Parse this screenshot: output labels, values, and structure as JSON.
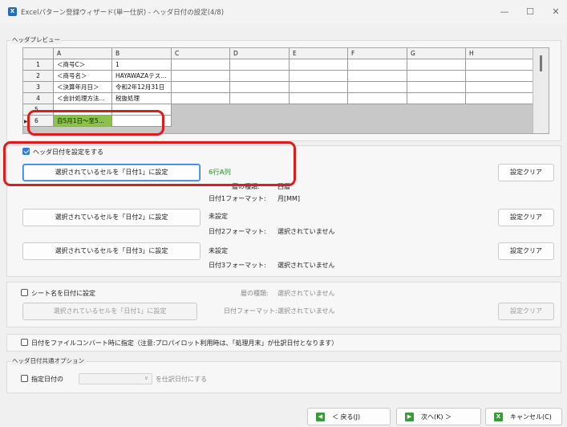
{
  "window": {
    "title": "Excelパターン登録ウィザード(単一仕訳) - ヘッダ日付の設定(4/8)",
    "app_icon_glyph": "X",
    "minimize_glyph": "—",
    "maximize_glyph": "☐",
    "close_glyph": "✕"
  },
  "preview": {
    "legend": "ヘッダプレビュー",
    "columns": [
      "A",
      "B",
      "C",
      "D",
      "E",
      "F",
      "G",
      "H"
    ],
    "rows": [
      {
        "num": "1",
        "a": "＜商号C＞",
        "b": "1"
      },
      {
        "num": "2",
        "a": "＜商号名＞",
        "b": "HAYAWAZAテス..."
      },
      {
        "num": "3",
        "a": "＜決算年月日＞",
        "b": "令和2年12月31日"
      },
      {
        "num": "4",
        "a": "＜会計処理方法...",
        "b": "税抜処理"
      },
      {
        "num": "5",
        "a": "",
        "b": ""
      },
      {
        "num": "6",
        "a": "自5月1日～至5...",
        "b": ""
      }
    ],
    "current_row_marker": "▶"
  },
  "header_date": {
    "checkbox_label": "ヘッダ日付を設定をする",
    "checked": true,
    "date1": {
      "button": "選択されているセルを「日付1」に設定",
      "status": "6行A列",
      "calendar_label": "暦の種類:",
      "calendar_value": "西暦",
      "format_label": "日付1フォーマット:",
      "format_value": "月[MM]",
      "clear": "設定クリア"
    },
    "date2": {
      "button": "選択されているセルを「日付2」に設定",
      "status": "未設定",
      "format_label": "日付2フォーマット:",
      "format_value": "選択されていません",
      "clear": "設定クリア"
    },
    "date3": {
      "button": "選択されているセルを「日付3」に設定",
      "status": "未設定",
      "format_label": "日付3フォーマット:",
      "format_value": "選択されていません",
      "clear": "設定クリア"
    }
  },
  "sheet_date": {
    "checkbox_label": "シート名を日付に設定",
    "button": "選択されているセルを「日付1」に設定",
    "calendar_label": "暦の種類:",
    "calendar_value": "選択されていません",
    "format_label": "日付フォーマット:",
    "format_value": "選択されていません",
    "clear": "設定クリア"
  },
  "file_convert": {
    "checkbox_label": "日付をファイルコンバート時に指定（注意:プロパイロット利用時は、「処理月末」が仕訳日付となります）"
  },
  "common_options": {
    "legend": "ヘッダ日付共通オプション",
    "checkbox_label": "指定日付の",
    "dropdown_arrow": "∨",
    "suffix": "を仕訳日付にする"
  },
  "footer": {
    "back": "＜ 戻る(J)",
    "next": "次へ(K) ＞",
    "cancel": "キャンセル(C)",
    "back_icon": "◀",
    "next_icon": "▶",
    "cancel_icon": "X",
    "back_icon_color": "#3a9b3a",
    "next_icon_color": "#3a9b3a",
    "cancel_icon_color": "#3a9b3a"
  },
  "highlight_color": "#e01b1b"
}
